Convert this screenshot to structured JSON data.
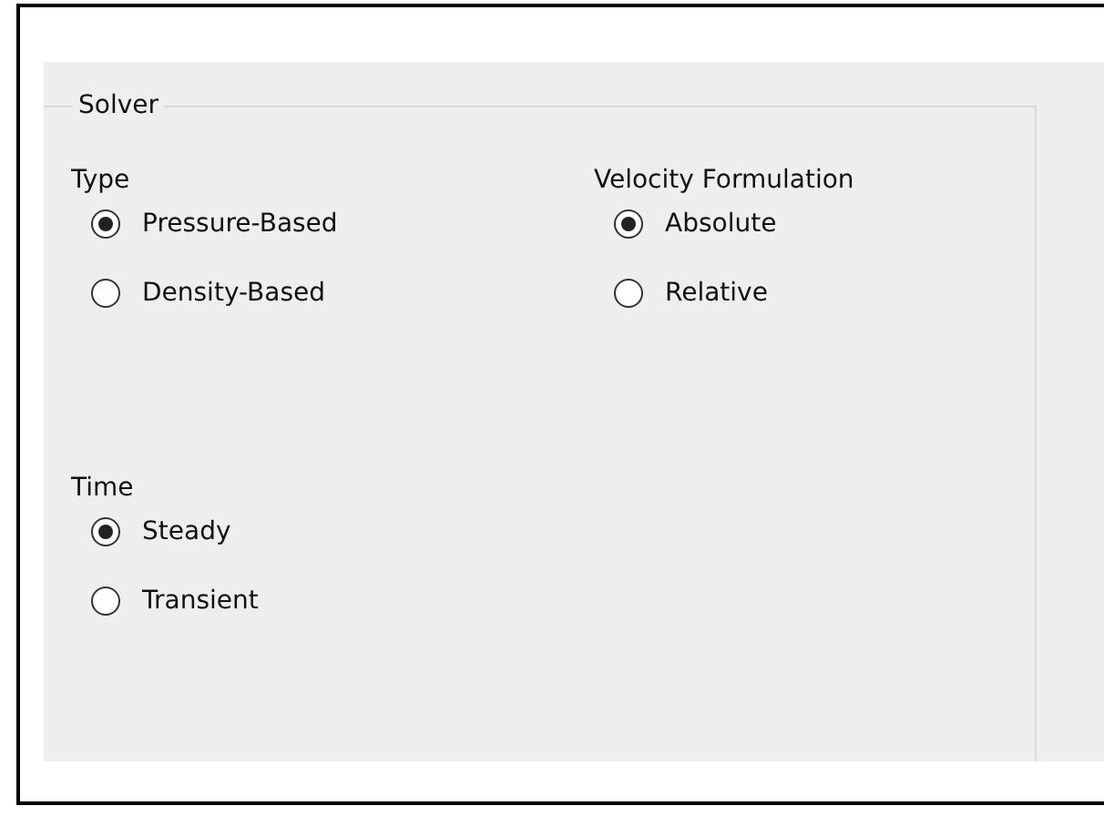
{
  "group": {
    "title": "Solver",
    "sections": [
      {
        "label": "Type",
        "options": [
          {
            "label": "Pressure-Based",
            "selected": true
          },
          {
            "label": "Density-Based",
            "selected": false
          }
        ]
      },
      {
        "label": "Velocity Formulation",
        "options": [
          {
            "label": "Absolute",
            "selected": true
          },
          {
            "label": "Relative",
            "selected": false
          }
        ]
      },
      {
        "label": "Time",
        "options": [
          {
            "label": "Steady",
            "selected": true
          },
          {
            "label": "Transient",
            "selected": false
          }
        ]
      }
    ]
  }
}
